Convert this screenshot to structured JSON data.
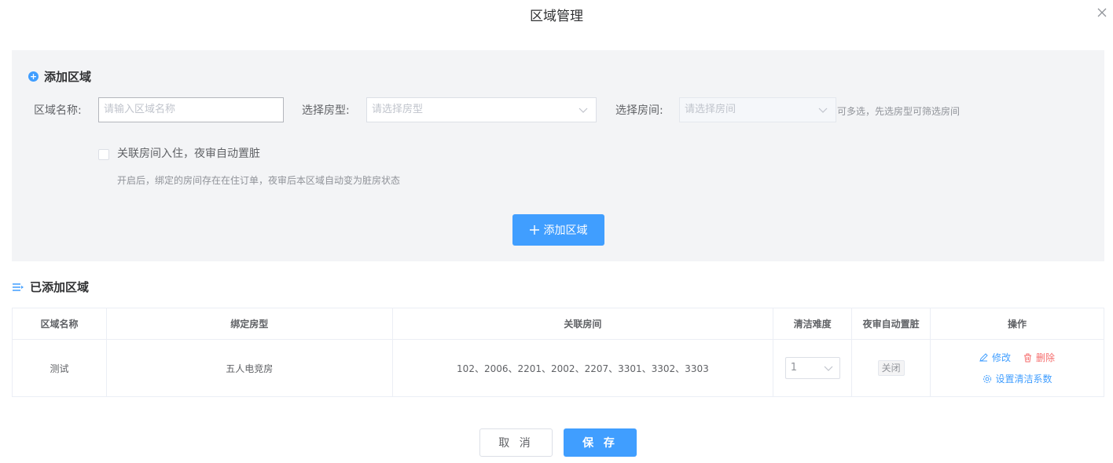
{
  "dialog": {
    "title": "区域管理"
  },
  "add_section": {
    "title": "添加区域",
    "name_label": "区域名称:",
    "name_placeholder": "请输入区域名称",
    "room_type_label": "选择房型:",
    "room_type_placeholder": "请选择房型",
    "room_label": "选择房间:",
    "room_placeholder": "请选择房间",
    "room_hint": "可多选，先选房型可筛选房间",
    "auto_dirty_label": "关联房间入住，夜审自动置脏",
    "auto_dirty_checked": false,
    "auto_dirty_hint": "开启后，绑定的房间存在在住订单，夜审后本区域自动变为脏房状态",
    "add_button": "添加区域"
  },
  "list_section": {
    "title": "已添加区域",
    "columns": [
      "区域名称",
      "绑定房型",
      "关联房间",
      "清洁难度",
      "夜审自动置脏",
      "操作"
    ],
    "rows": [
      {
        "name": "测试",
        "room_type": "五人电竞房",
        "rooms": "102、2006、2201、2002、2207、3301、3302、3303",
        "difficulty": "1",
        "auto_dirty": "关闭",
        "edit": "修改",
        "delete": "删除",
        "set_coefficient": "设置清洁系数"
      }
    ]
  },
  "footer": {
    "cancel": "取 消",
    "save": "保 存"
  },
  "colors": {
    "primary": "#409eff",
    "danger": "#f56c6c",
    "panel_bg": "#f3f4f6"
  }
}
